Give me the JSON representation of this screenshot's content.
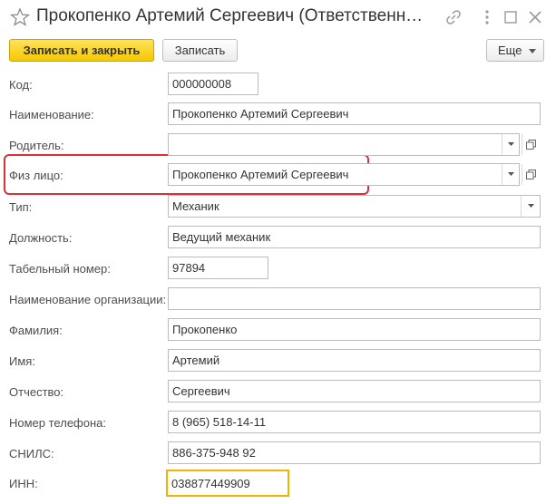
{
  "window": {
    "title": "Прокопенко Артемий Сергеевич (Ответственн…"
  },
  "toolbar": {
    "save_close_label": "Записать и закрыть",
    "save_label": "Записать",
    "more_label": "Еще"
  },
  "fields": {
    "code": {
      "label": "Код:",
      "value": "000000008"
    },
    "name": {
      "label": "Наименование:",
      "value": "Прокопенко Артемий Сергеевич"
    },
    "parent": {
      "label": "Родитель:",
      "value": ""
    },
    "person": {
      "label": "Физ лицо:",
      "value": "Прокопенко Артемий Сергеевич"
    },
    "type": {
      "label": "Тип:",
      "value": "Механик"
    },
    "position": {
      "label": "Должность:",
      "value": "Ведущий механик"
    },
    "tab_number": {
      "label": "Табельный номер:",
      "value": "97894"
    },
    "org_name": {
      "label": "Наименование организации:",
      "value": ""
    },
    "surname": {
      "label": "Фамилия:",
      "value": "Прокопенко"
    },
    "first_name": {
      "label": "Имя:",
      "value": "Артемий"
    },
    "patronymic": {
      "label": "Отчество:",
      "value": "Сергеевич"
    },
    "phone": {
      "label": "Номер телефона:",
      "value": "8 (965) 518-14-11"
    },
    "snils": {
      "label": "СНИЛС:",
      "value": "886-375-948 92"
    },
    "inn": {
      "label": "ИНН:",
      "value": "038877449909"
    }
  },
  "colors": {
    "primary_button": "#f5c800",
    "highlight_border": "#d9303a",
    "focus_border": "#f2b200"
  }
}
